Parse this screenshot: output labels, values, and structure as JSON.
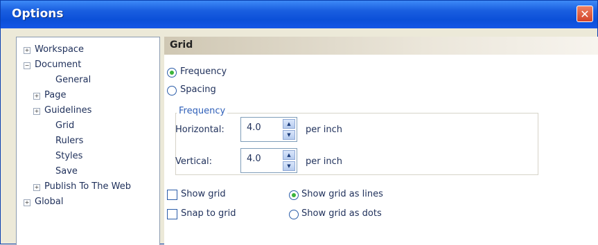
{
  "window": {
    "title": "Options",
    "close_glyph": "✕"
  },
  "tree": [
    {
      "label": "Workspace",
      "expander": "+",
      "indent": 0
    },
    {
      "label": "Document",
      "expander": "−",
      "indent": 0
    },
    {
      "label": "General",
      "expander": null,
      "indent": 2
    },
    {
      "label": "Page",
      "expander": "+",
      "indent": 1
    },
    {
      "label": "Guidelines",
      "expander": "+",
      "indent": 1
    },
    {
      "label": "Grid",
      "expander": null,
      "indent": 2
    },
    {
      "label": "Rulers",
      "expander": null,
      "indent": 2
    },
    {
      "label": "Styles",
      "expander": null,
      "indent": 2
    },
    {
      "label": "Save",
      "expander": null,
      "indent": 2
    },
    {
      "label": "Publish To The Web",
      "expander": "+",
      "indent": 1
    },
    {
      "label": "Global",
      "expander": "+",
      "indent": 0
    }
  ],
  "panel": {
    "title": "Grid",
    "mode_options": [
      {
        "label": "Frequency",
        "selected": true
      },
      {
        "label": "Spacing",
        "selected": false
      }
    ],
    "group_title": "Frequency",
    "horizontal": {
      "label": "Horizontal:",
      "value": "4.0",
      "unit": "per inch"
    },
    "vertical": {
      "label": "Vertical:",
      "value": "4.0",
      "unit": "per inch"
    },
    "show_grid": {
      "label": "Show grid",
      "checked": false
    },
    "snap_to_grid": {
      "label": "Snap to grid",
      "checked": false
    },
    "display_options": [
      {
        "label": "Show grid as lines",
        "selected": true
      },
      {
        "label": "Show grid as dots",
        "selected": false
      }
    ]
  }
}
